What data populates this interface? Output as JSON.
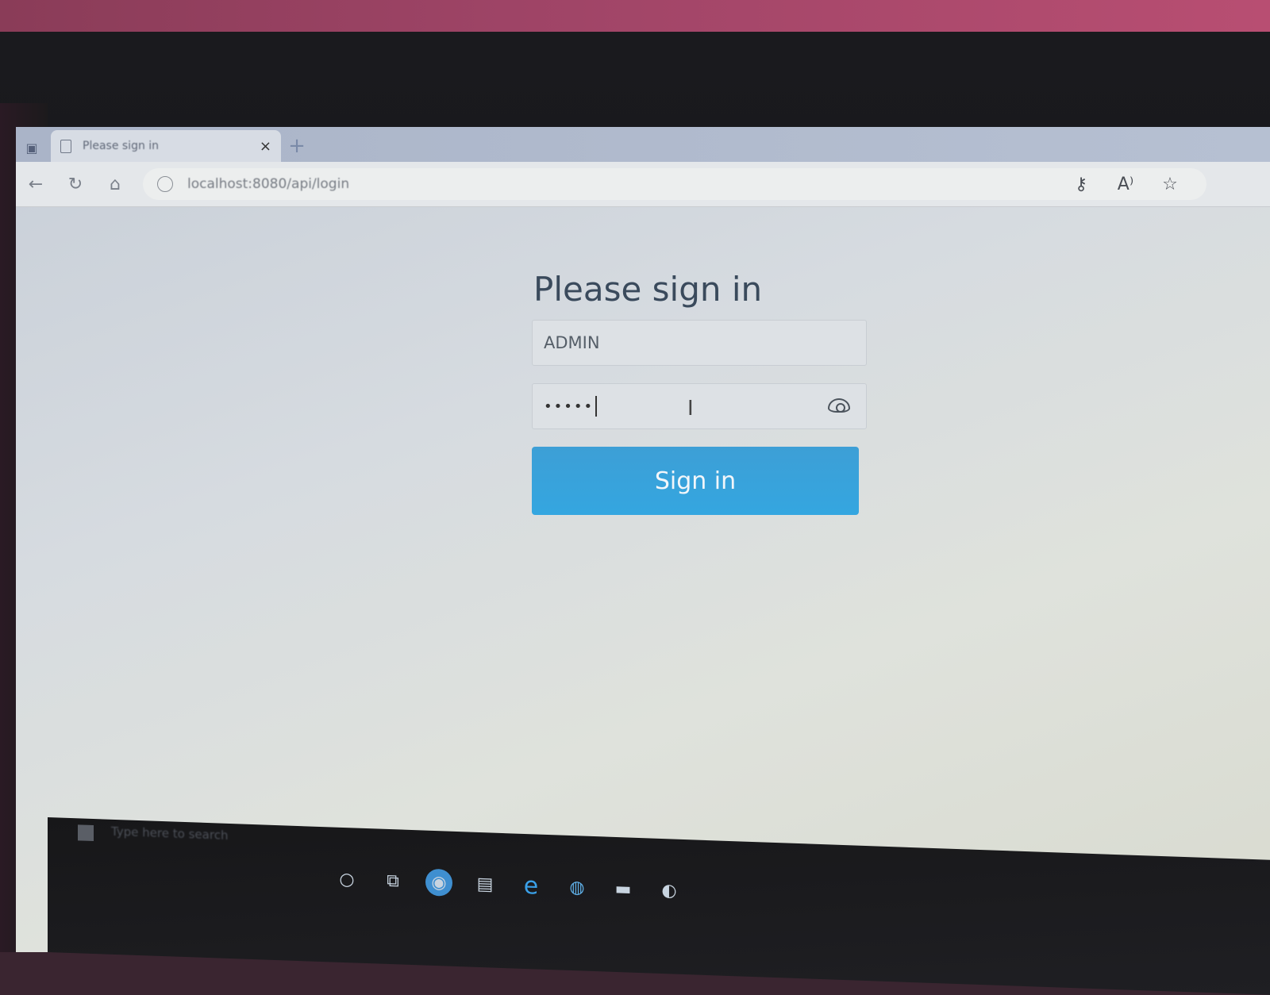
{
  "browser": {
    "tab": {
      "title": "Please sign in",
      "close_glyph": "×"
    },
    "new_tab_glyph": "+",
    "nav": {
      "back": "←",
      "refresh": "↻",
      "home": "⌂"
    },
    "address_bar": {
      "url": "localhost:8080/api/login"
    },
    "toolbar": {
      "passwords": "⚷",
      "read_aloud": "A⁾",
      "favorites": "☆"
    }
  },
  "login": {
    "heading": "Please sign in",
    "username_value": "ADMIN",
    "password_mask": "•••••",
    "submit_label": "Sign in"
  },
  "taskbar": {
    "search_placeholder": "Type here to search",
    "icons": [
      {
        "name": "cortana-icon",
        "glyph": "○"
      },
      {
        "name": "task-view-icon",
        "glyph": "⧉"
      },
      {
        "name": "app-icon",
        "glyph": "◉"
      },
      {
        "name": "file-explorer-icon",
        "glyph": "▤"
      },
      {
        "name": "edge-icon",
        "glyph": "e"
      },
      {
        "name": "chrome-icon",
        "glyph": "◍"
      },
      {
        "name": "terminal-icon",
        "glyph": "▬"
      },
      {
        "name": "app-icon-2",
        "glyph": "◐"
      }
    ]
  },
  "colors": {
    "primary_button": "#34a6e0",
    "heading_text": "#3a4a5c"
  }
}
